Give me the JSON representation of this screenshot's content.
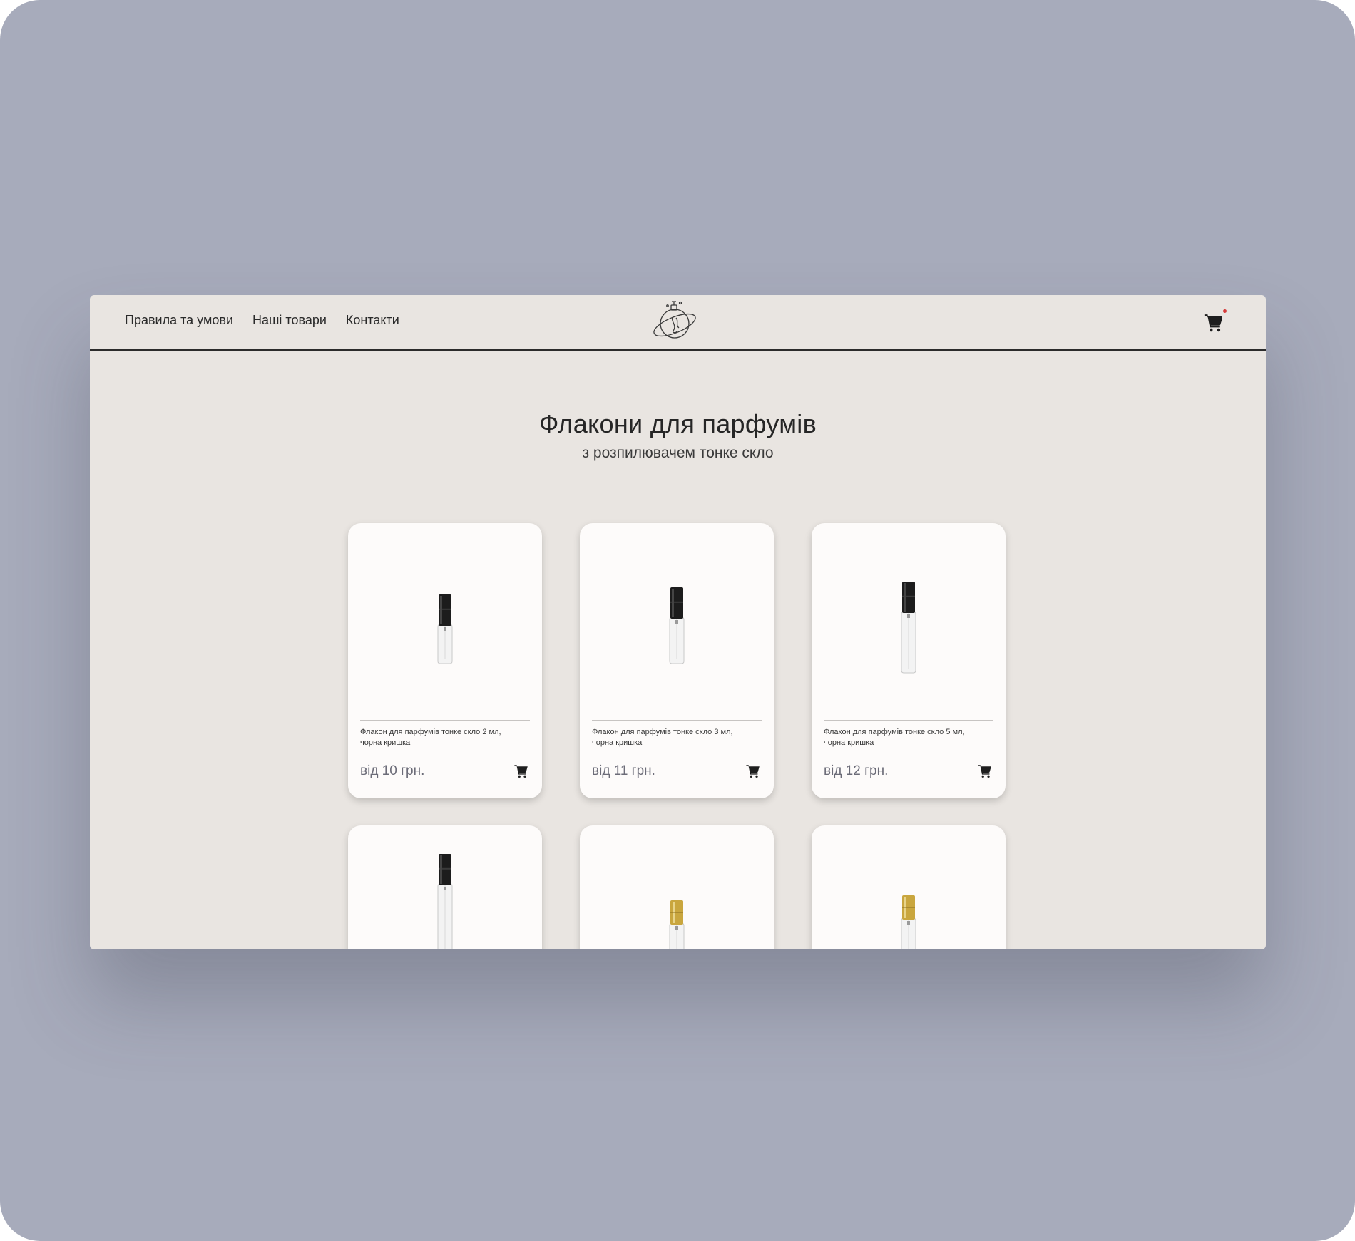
{
  "nav": {
    "items": [
      {
        "label": "Правила та умови"
      },
      {
        "label": "Наші товари"
      },
      {
        "label": "Контакти"
      }
    ]
  },
  "header": {
    "logo_icon": "planet-bottle-logo",
    "cart_icon": "cart-icon"
  },
  "hero": {
    "title": "Флакони для парфумів",
    "subtitle": "з розпилювачем тонке скло"
  },
  "products": [
    {
      "name": "Флакон для парфумів тонке скло 2 мл, чорна кришка",
      "price": "від 10 грн.",
      "cap_color": "#1c1c1c"
    },
    {
      "name": "Флакон для парфумів тонке скло 3 мл, чорна кришка",
      "price": "від 11 грн.",
      "cap_color": "#1c1c1c"
    },
    {
      "name": "Флакон для парфумів тонке скло 5 мл, чорна кришка",
      "price": "від 12 грн.",
      "cap_color": "#1c1c1c"
    },
    {
      "name": "",
      "price": "",
      "cap_color": "#1c1c1c"
    },
    {
      "name": "",
      "price": "",
      "cap_color": "#c9a63e"
    },
    {
      "name": "",
      "price": "",
      "cap_color": "#c9a63e"
    }
  ],
  "colors": {
    "background": "#a7abbb",
    "page": "#e9e5e1",
    "card": "#fdfbfa",
    "cart_badge": "#d63a3a"
  }
}
